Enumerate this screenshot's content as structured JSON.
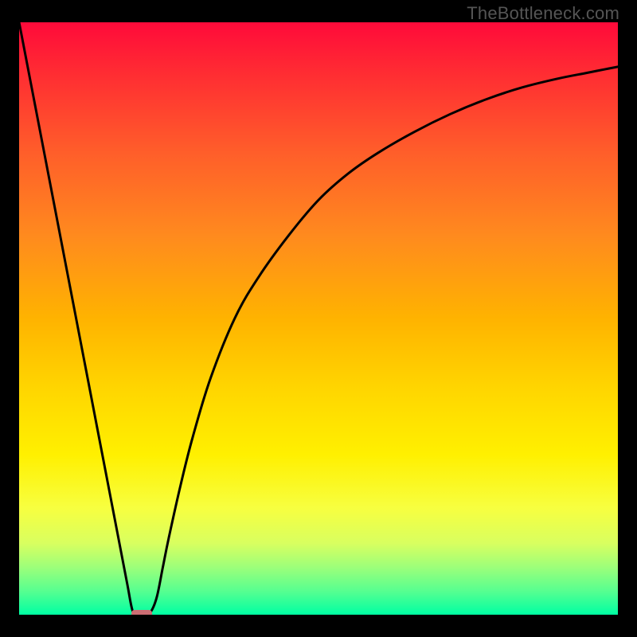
{
  "watermark": "TheBottleneck.com",
  "colors": {
    "curve": "#000000",
    "marker": "#cc6d73",
    "frame": "#000000"
  },
  "chart_data": {
    "type": "line",
    "title": "",
    "xlabel": "",
    "ylabel": "",
    "xlim": [
      0,
      100
    ],
    "ylim": [
      0,
      100
    ],
    "series": [
      {
        "name": "bottleneck-curve",
        "x": [
          0,
          2,
          4,
          6,
          8,
          10,
          12,
          14,
          16,
          18,
          19,
          20,
          21,
          22,
          23,
          24,
          25,
          27,
          29,
          32,
          36,
          40,
          45,
          50,
          55,
          60,
          66,
          72,
          78,
          84,
          90,
          95,
          100
        ],
        "y": [
          100,
          89.5,
          79,
          68.5,
          58,
          47.5,
          37,
          26.5,
          16,
          5.5,
          0.5,
          0,
          0,
          0.5,
          3,
          8,
          13,
          22,
          30,
          40,
          50,
          57,
          64,
          70,
          74.5,
          78,
          81.5,
          84.5,
          87,
          89,
          90.5,
          91.5,
          92.5
        ]
      }
    ],
    "marker": {
      "x_start": 19,
      "x_end": 22,
      "y": 0
    },
    "grid": false,
    "legend": false
  }
}
